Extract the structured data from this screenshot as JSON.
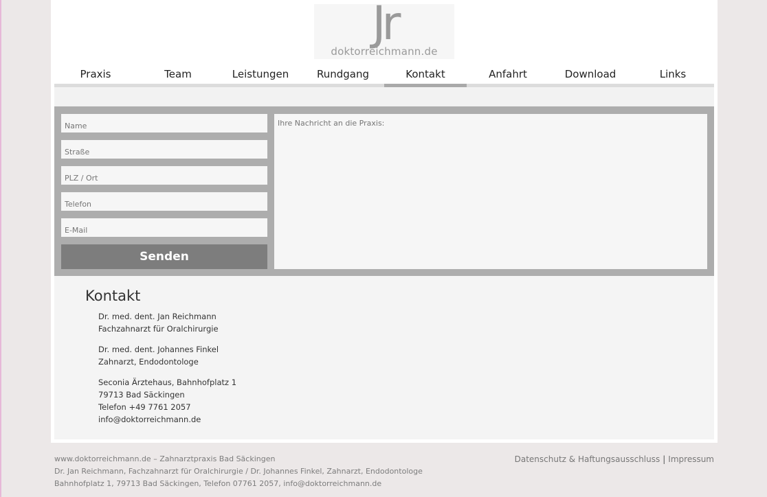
{
  "logo": {
    "glyph": "Jr",
    "wordmark": "doktorreichmann.de"
  },
  "nav": {
    "items": [
      "Praxis",
      "Team",
      "Leistungen",
      "Rundgang",
      "Kontakt",
      "Anfahrt",
      "Download",
      "Links"
    ],
    "active": "Kontakt"
  },
  "form": {
    "name_placeholder": "Name",
    "street_placeholder": "Straße",
    "city_placeholder": "PLZ / Ort",
    "phone_placeholder": "Telefon",
    "email_placeholder": "E-Mail",
    "message_placeholder": "Ihre Nachricht an die Praxis:",
    "send_label": "Senden"
  },
  "contact": {
    "title": "Kontakt",
    "doctor1_name": "Dr. med. dent. Jan Reichmann",
    "doctor1_title": "Fachzahnarzt für Oralchirurgie",
    "doctor2_name": "Dr. med. dent. Johannes Finkel",
    "doctor2_title": "Zahnarzt, Endodontologe",
    "address_line1": "Seconia Ärztehaus, Bahnhofplatz 1",
    "address_line2": "79713 Bad Säckingen",
    "phone": "Telefon +49 7761 2057",
    "email": "info@doktorreichmann.de"
  },
  "footer": {
    "line1": "www.doktorreichmann.de – Zahnarztpraxis Bad Säckingen",
    "line2": "Dr. Jan Reichmann, Fachzahnarzt für Oralchirurgie / Dr. Johannes Finkel, Zahnarzt, Endodontologe",
    "line3": "Bahnhofplatz 1, 79713 Bad Säckingen, Telefon 07761 2057, info@doktorreichmann.de",
    "datenschutz_label": "Datenschutz & Haftungsausschluss",
    "separator": "|",
    "impressum_label": "Impressum"
  }
}
